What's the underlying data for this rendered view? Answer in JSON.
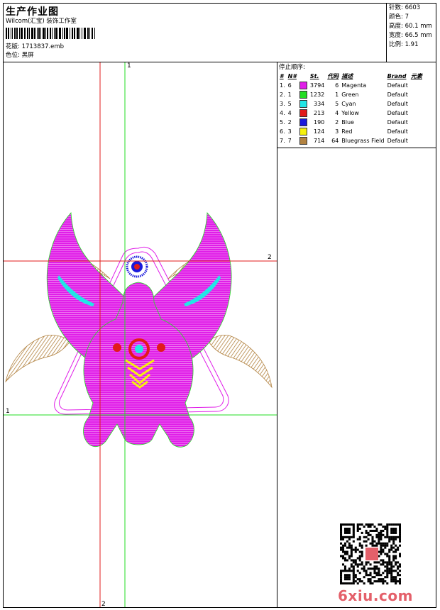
{
  "header": {
    "title": "生产作业图",
    "company": "Wilcom(汇宝) 装饰工作室",
    "design_file": "花版: 1713837.emb",
    "color_scheme": "色位: 黑屏"
  },
  "stats": [
    "针数: 6603",
    "颜色: 7",
    "高度: 60.1 mm",
    "宽度: 66.5 mm",
    "比例: 1.91"
  ],
  "stop_sequence": {
    "heading": "停止顺序:",
    "columns": [
      "#",
      "N#",
      "St.",
      "代码",
      "描述",
      "Brand",
      "元素"
    ],
    "rows": [
      {
        "idx": "1.",
        "n": "6",
        "color": "#e01ee8",
        "st": "3794",
        "code": "6",
        "desc": "Magenta",
        "brand": "Default"
      },
      {
        "idx": "2.",
        "n": "1",
        "color": "#22dd22",
        "st": "1232",
        "code": "1",
        "desc": "Green",
        "brand": "Default"
      },
      {
        "idx": "3.",
        "n": "5",
        "color": "#22e6e6",
        "st": "334",
        "code": "5",
        "desc": "Cyan",
        "brand": "Default"
      },
      {
        "idx": "4.",
        "n": "4",
        "color": "#e11b1b",
        "st": "213",
        "code": "4",
        "desc": "Yellow",
        "brand": "Default"
      },
      {
        "idx": "5.",
        "n": "2",
        "color": "#1a1adc",
        "st": "190",
        "code": "2",
        "desc": "Blue",
        "brand": "Default"
      },
      {
        "idx": "6.",
        "n": "3",
        "color": "#f5f10c",
        "st": "124",
        "code": "3",
        "desc": "Red",
        "brand": "Default"
      },
      {
        "idx": "7.",
        "n": "7",
        "color": "#b28240",
        "st": "714",
        "code": "64",
        "desc": "Bluegrass Field",
        "brand": "Default"
      }
    ]
  },
  "guides": {
    "green_v_top": "1",
    "red_h_right": "2",
    "green_h_left": "1",
    "red_v_bottom": "2"
  },
  "watermark": {
    "brand": "6xiu.com"
  },
  "colors": {
    "magenta": "#e01ee8",
    "green": "#22dd22",
    "cyan": "#22e6e6",
    "red": "#e11b1b",
    "blue": "#1a1adc",
    "yellow": "#f5f10c",
    "brown": "#b28240",
    "watermark": "#e4606a"
  }
}
